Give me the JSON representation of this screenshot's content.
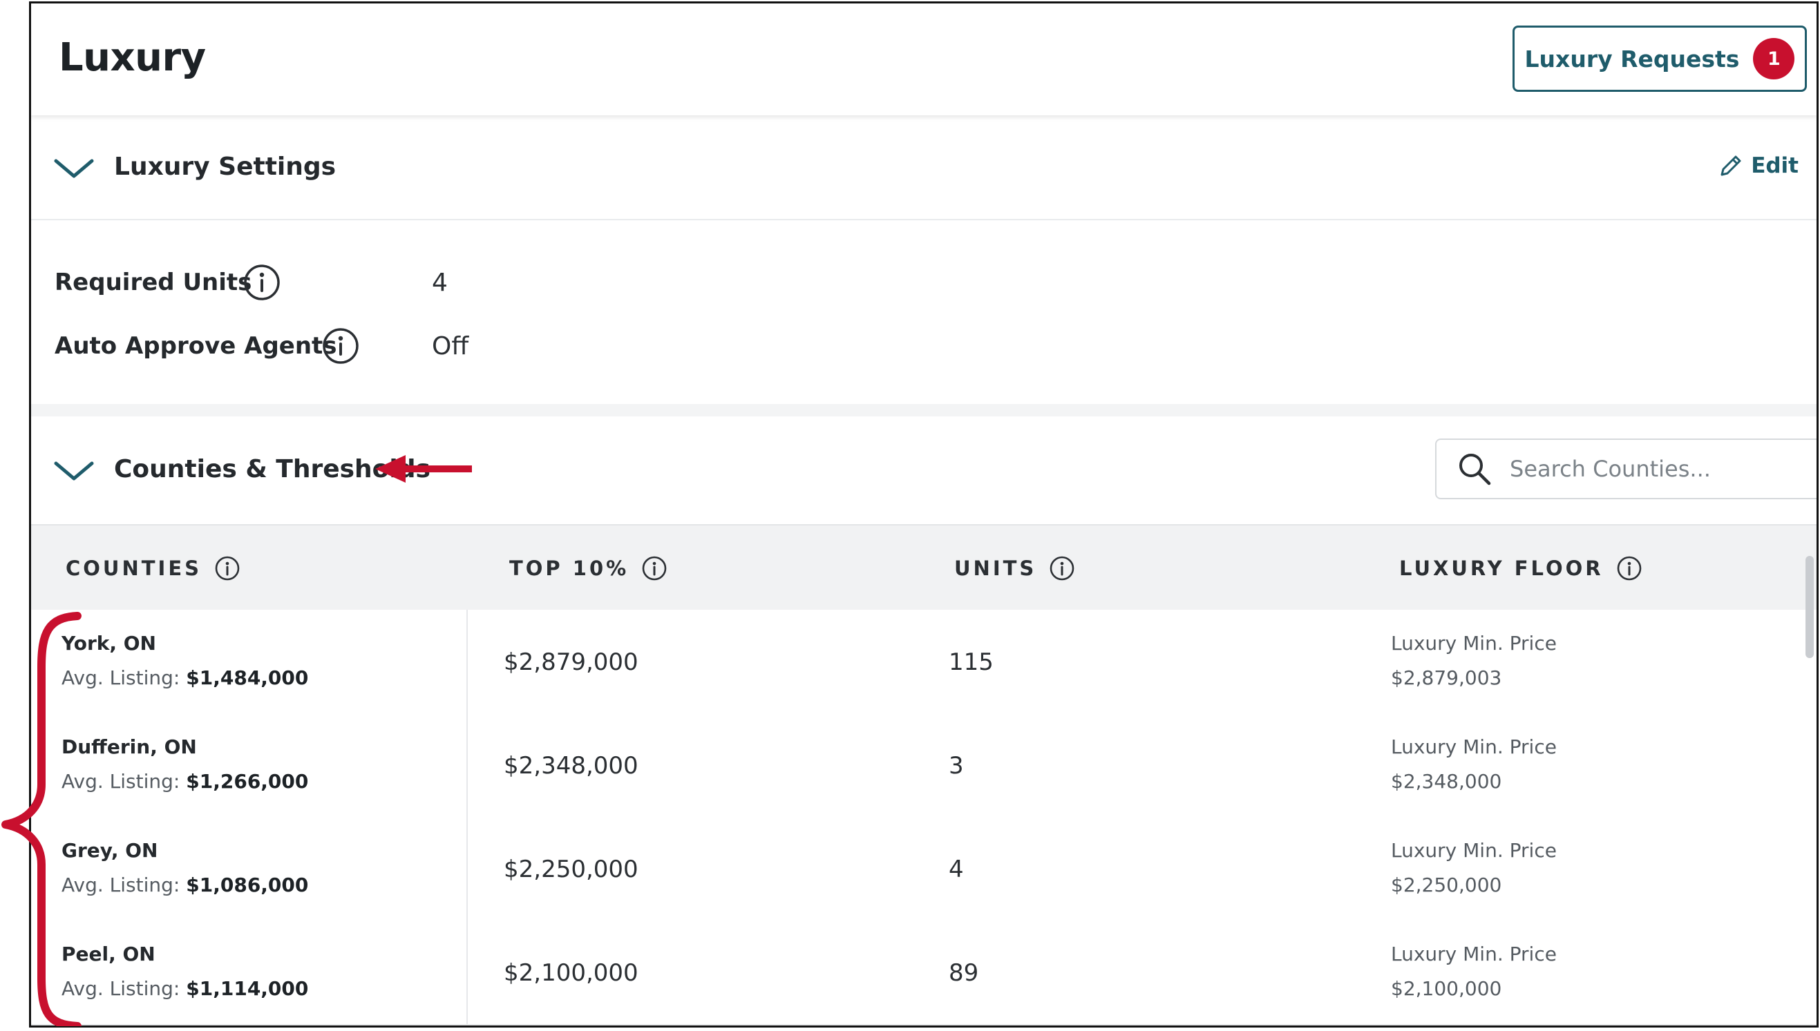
{
  "header": {
    "title": "Luxury",
    "requests_label": "Luxury Requests",
    "requests_count": "1"
  },
  "settings_section": {
    "title": "Luxury Settings",
    "edit_label": "Edit",
    "items": [
      {
        "label": "Required Units",
        "value": "4"
      },
      {
        "label": "Auto Approve Agents",
        "value": "Off"
      }
    ]
  },
  "counties_section": {
    "title": "Counties & Thresholds",
    "search_placeholder": "Search Counties..."
  },
  "table": {
    "headers": [
      "COUNTIES",
      "TOP 10%",
      "UNITS",
      "LUXURY FLOOR"
    ],
    "avg_prefix": "Avg. Listing:",
    "floor_label": "Luxury Min. Price",
    "rows": [
      {
        "county": "York, ON",
        "avg": "$1,484,000",
        "top10": "$2,879,000",
        "units": "115",
        "floor": "$2,879,003"
      },
      {
        "county": "Dufferin, ON",
        "avg": "$1,266,000",
        "top10": "$2,348,000",
        "units": "3",
        "floor": "$2,348,000"
      },
      {
        "county": "Grey, ON",
        "avg": "$1,086,000",
        "top10": "$2,250,000",
        "units": "4",
        "floor": "$2,250,000"
      },
      {
        "county": "Peel, ON",
        "avg": "$1,114,000",
        "top10": "$2,100,000",
        "units": "89",
        "floor": "$2,100,000"
      }
    ]
  },
  "colors": {
    "accent": "#1f5c6b",
    "badge": "#c8102e",
    "annotation": "#c8102e"
  },
  "icons": [
    "chevron-down-icon",
    "info-icon",
    "pencil-icon",
    "search-icon",
    "annotation-arrow",
    "annotation-brace"
  ]
}
